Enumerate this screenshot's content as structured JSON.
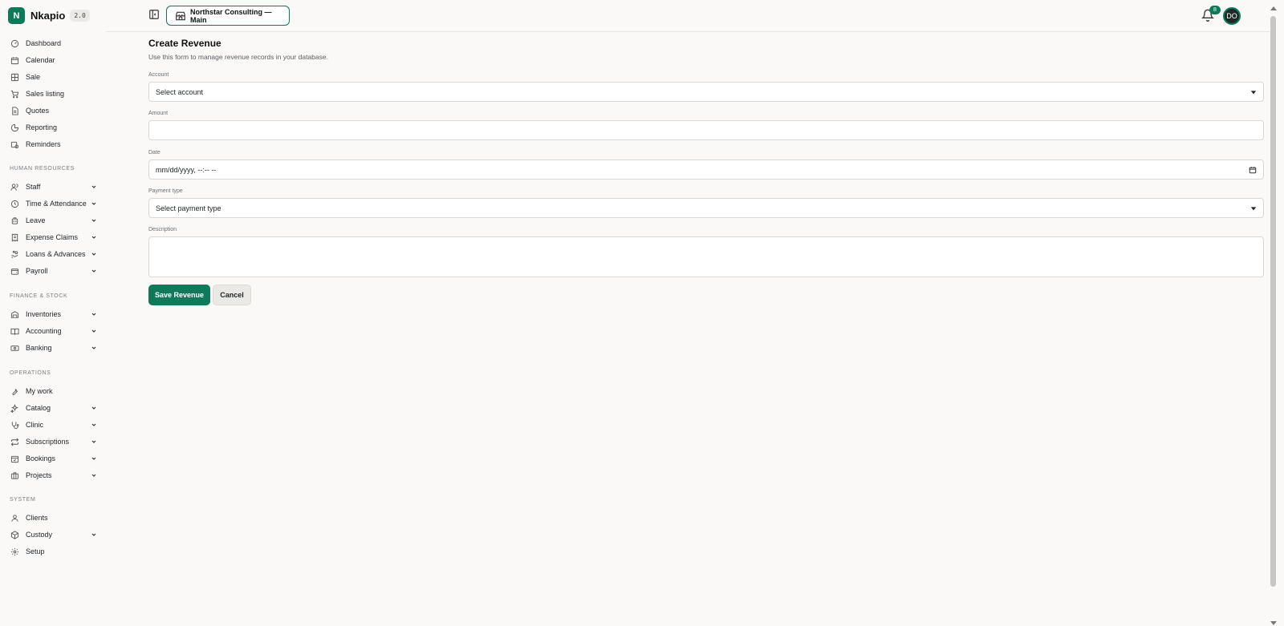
{
  "brand": {
    "name": "Nkapio",
    "version": "2.0",
    "logo_letter": "N",
    "accent": "#0e7a5a"
  },
  "nav_top": [
    {
      "label": "Dashboard",
      "icon": "dashboard-icon"
    },
    {
      "label": "Calendar",
      "icon": "calendar-icon"
    },
    {
      "label": "Sale",
      "icon": "grid-icon"
    },
    {
      "label": "Sales listing",
      "icon": "cart-icon"
    },
    {
      "label": "Quotes",
      "icon": "document-icon"
    },
    {
      "label": "Reporting",
      "icon": "pie-chart-icon"
    },
    {
      "label": "Reminders",
      "icon": "calendar-clock-icon"
    }
  ],
  "sections": {
    "hr": {
      "title": "HUMAN RESOURCES",
      "items": [
        {
          "label": "Staff",
          "icon": "users-icon"
        },
        {
          "label": "Time & Attendance",
          "icon": "clock-icon"
        },
        {
          "label": "Leave",
          "icon": "luggage-icon"
        },
        {
          "label": "Expense Claims",
          "icon": "receipt-icon"
        },
        {
          "label": "Loans & Advances",
          "icon": "hand-coins-icon"
        },
        {
          "label": "Payroll",
          "icon": "wallet-icon"
        }
      ]
    },
    "finance": {
      "title": "FINANCE & STOCK",
      "items": [
        {
          "label": "Inventories",
          "icon": "warehouse-icon"
        },
        {
          "label": "Accounting",
          "icon": "book-icon"
        },
        {
          "label": "Banking",
          "icon": "banknote-icon"
        }
      ]
    },
    "operations": {
      "title": "OPERATIONS",
      "items": [
        {
          "label": "My work",
          "icon": "wrench-icon"
        },
        {
          "label": "Catalog",
          "icon": "sparkles-icon"
        },
        {
          "label": "Clinic",
          "icon": "stethoscope-icon"
        },
        {
          "label": "Subscriptions",
          "icon": "repeat-icon"
        },
        {
          "label": "Bookings",
          "icon": "calendar-check-icon"
        },
        {
          "label": "Projects",
          "icon": "briefcase-icon"
        }
      ]
    },
    "system": {
      "title": "SYSTEM",
      "items": [
        {
          "label": "Clients",
          "icon": "user-icon"
        },
        {
          "label": "Custody",
          "icon": "box-icon"
        },
        {
          "label": "Setup",
          "icon": "gear-icon"
        }
      ]
    }
  },
  "header": {
    "workspace": "Northstar Consulting — Main",
    "notification_count": "8",
    "avatar_initials": "DO"
  },
  "form": {
    "title": "Create Revenue",
    "subtitle": "Use this form to manage revenue records in your database.",
    "account_label": "Account",
    "account_value": "Select account",
    "amount_label": "Amount",
    "amount_value": "",
    "date_label": "Date",
    "date_placeholder": "mm/dd/yyyy, --:-- --",
    "payment_label": "Payment type",
    "payment_value": "Select payment type",
    "description_label": "Description",
    "description_value": "",
    "save_label": "Save Revenue",
    "cancel_label": "Cancel"
  }
}
